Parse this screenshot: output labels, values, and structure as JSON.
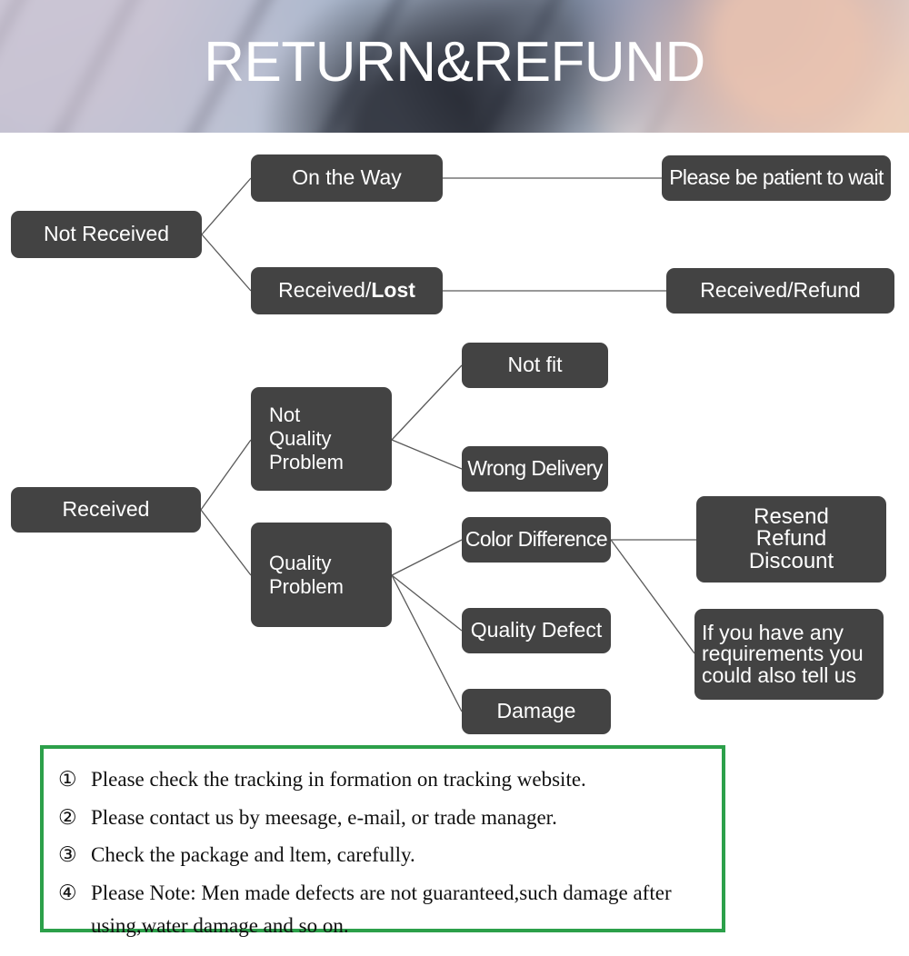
{
  "banner": {
    "title": "RETURN&REFUND",
    "title_color": "#ffffff"
  },
  "theme": {
    "node_bg": "#434343",
    "node_text": "#ffffff",
    "connector": "#5a5a5a",
    "note_border": "#2ca04a",
    "note_text": "#111111"
  },
  "flowchart": {
    "nodes": {
      "not_received": "Not Received",
      "on_the_way": "On the Way",
      "received_lost_prefix": "Received/",
      "received_lost_bold": "Lost",
      "please_be_patient": "Please be patient to wait",
      "received_refund": "Received/Refund",
      "received": "Received",
      "not_quality_problem": "Not\nQuality\nProblem",
      "not_fit": "Not fit",
      "wrong_delivery": "Wrong Delivery",
      "quality_problem": "Quality\nProblem",
      "color_difference": "Color Difference",
      "quality_defect": "Quality Defect",
      "damage": "Damage",
      "resend_refund_discount": "Resend\nRefund\nDiscount",
      "if_you_have_any": "If you have any\nrequirements you\ncould also tell us"
    }
  },
  "notes": {
    "items": [
      {
        "num": "①",
        "text": "Please check the tracking in formation on tracking website."
      },
      {
        "num": "②",
        "text": "Please contact us by meesage, e-mail, or trade manager."
      },
      {
        "num": "③",
        "text": "Check the package and ltem, carefully."
      },
      {
        "num": "④",
        "text": "Please Note: Men made defects  are not guaranteed,such damage after using,water damage and so on."
      }
    ]
  }
}
